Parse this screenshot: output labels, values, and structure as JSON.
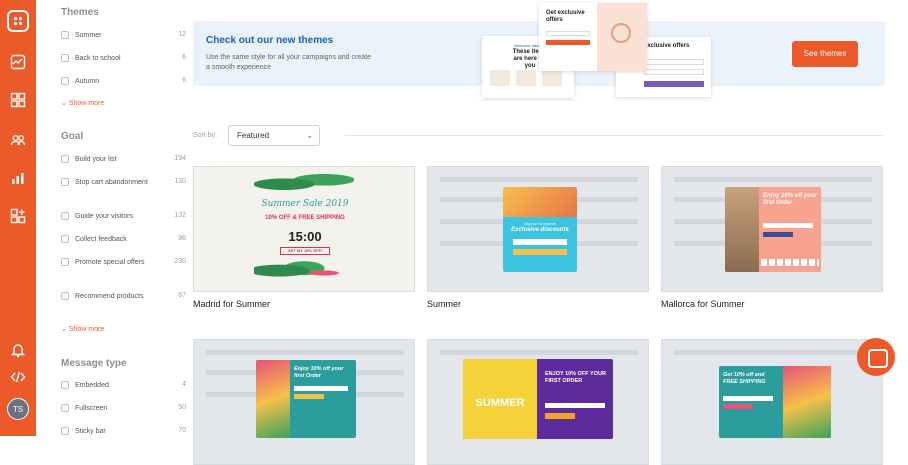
{
  "rail": {
    "icons": [
      "logo-icon",
      "analytics-icon",
      "templates-icon",
      "subscribers-icon",
      "reports-icon",
      "integrations-icon",
      "notifications-icon",
      "code-icon"
    ],
    "avatar_initials": "TS",
    "accent": "#ed5a29"
  },
  "filters": {
    "themes": {
      "heading": "Themes",
      "items": [
        {
          "label": "Summer",
          "count": "12"
        },
        {
          "label": "Back to school",
          "count": "6"
        },
        {
          "label": "Autumn",
          "count": "6"
        }
      ],
      "more": "Show more"
    },
    "goal": {
      "heading": "Goal",
      "items": [
        {
          "label": "Build your list",
          "count": "194"
        },
        {
          "label": "Stop cart abandonment",
          "count": "130"
        },
        {
          "label": "Guide your visitors",
          "count": "132"
        },
        {
          "label": "Collect feedback",
          "count": "96"
        },
        {
          "label": "Promote special offers",
          "count": "230"
        },
        {
          "label": "Recommend products",
          "count": "67"
        }
      ],
      "more": "Show more"
    },
    "message_type": {
      "heading": "Message type",
      "items": [
        {
          "label": "Embedded",
          "count": "4"
        },
        {
          "label": "Fullscreen",
          "count": "50"
        },
        {
          "label": "Sticky bar",
          "count": "70"
        }
      ]
    }
  },
  "banner": {
    "title": "Check out our new themes",
    "text": "Use the same style for all your campaigns and create a smooth experience",
    "button": "See themes",
    "preview": {
      "welcome": "Welcome back!",
      "these_items": "These items are here for you",
      "get_exclusive": "Get exclusive offers",
      "exclusive_offers": "exclusive offers"
    }
  },
  "sort": {
    "label": "Sort by:",
    "value": "Featured"
  },
  "cards": [
    {
      "name": "Madrid for Summer",
      "title": "Summer Sale 2019",
      "offer": "10% OFF & FREE SHIPPING",
      "timer": "15:00",
      "cta": "GET MY 10% OFF!"
    },
    {
      "name": "Summer",
      "title": "Sign up to receive",
      "subtitle": "Exclusive discounts"
    },
    {
      "name": "Mallorca for Summer",
      "title": "Enjoy 10% off your first Order"
    },
    {
      "title": "Enjoy 10% off your first Order"
    },
    {
      "title": "ENJOY 10% OFF YOUR FIRST ORDER",
      "tag": "SUMMER"
    },
    {
      "title": "Get 10% off and FREE SHIPPING"
    }
  ]
}
